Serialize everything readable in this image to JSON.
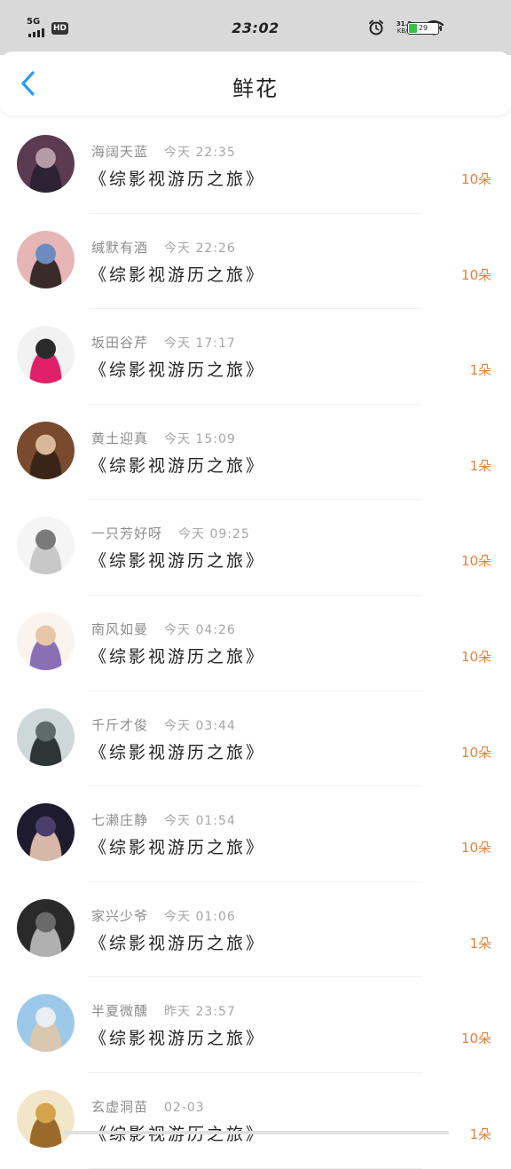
{
  "status_bar": {
    "network": "5G",
    "hd": "HD",
    "time": "23:02",
    "speed_value": "31.8",
    "speed_unit": "KB/s",
    "battery": "29",
    "battery_color": "#38c14a"
  },
  "header": {
    "back_icon": "chevron-left-icon",
    "title": "鲜花",
    "accent": "#2a9df4"
  },
  "list": [
    {
      "name": "海阔天蓝",
      "time": "今天 22:35",
      "book": "《综影视游历之旅》",
      "qty": "10朵",
      "avatar_colors": [
        "#5a3b4f",
        "#b59aa8",
        "#2d2233"
      ]
    },
    {
      "name": "缄默有酒",
      "time": "今天 22:26",
      "book": "《综影视游历之旅》",
      "qty": "10朵",
      "avatar_colors": [
        "#e6b6b6",
        "#6a8cbf",
        "#3a2b28"
      ]
    },
    {
      "name": "坂田谷芹",
      "time": "今天 17:17",
      "book": "《综影视游历之旅》",
      "qty": "1朵",
      "avatar_colors": [
        "#f2f2f2",
        "#2a2a2a",
        "#e0216a"
      ]
    },
    {
      "name": "黄土迎真",
      "time": "今天 15:09",
      "book": "《综影视游历之旅》",
      "qty": "1朵",
      "avatar_colors": [
        "#7a4a2e",
        "#d9b79a",
        "#3a2418"
      ]
    },
    {
      "name": "一只芳好呀",
      "time": "今天 09:25",
      "book": "《综影视游历之旅》",
      "qty": "10朵",
      "avatar_colors": [
        "#f5f5f5",
        "#7a7a7a",
        "#c8c8c8"
      ]
    },
    {
      "name": "南风如曼",
      "time": "今天 04:26",
      "book": "《综影视游历之旅》",
      "qty": "10朵",
      "avatar_colors": [
        "#fbf3ee",
        "#e7c7a8",
        "#8b6fb5"
      ]
    },
    {
      "name": "千斤才俊",
      "time": "今天 03:44",
      "book": "《综影视游历之旅》",
      "qty": "10朵",
      "avatar_colors": [
        "#cfd8d8",
        "#5f6b6b",
        "#2c3636"
      ]
    },
    {
      "name": "七濑庄静",
      "time": "今天 01:54",
      "book": "《综影视游历之旅》",
      "qty": "10朵",
      "avatar_colors": [
        "#1f1b2e",
        "#4a3f6a",
        "#d7b7a8"
      ]
    },
    {
      "name": "家兴少爷",
      "time": "今天 01:06",
      "book": "《综影视游历之旅》",
      "qty": "1朵",
      "avatar_colors": [
        "#2a2a2a",
        "#6a6a6a",
        "#b0b0b0"
      ]
    },
    {
      "name": "半夏微醺",
      "time": "昨天 23:57",
      "book": "《综影视游历之旅》",
      "qty": "10朵",
      "avatar_colors": [
        "#9cc9ea",
        "#e8eef2",
        "#d9c7b0"
      ]
    },
    {
      "name": "玄虚洞苗",
      "time": "02-03",
      "book": "《综影视游历之旅》",
      "qty": "1朵",
      "avatar_colors": [
        "#f3e6c8",
        "#d4a34a",
        "#9a6a2a"
      ]
    }
  ]
}
